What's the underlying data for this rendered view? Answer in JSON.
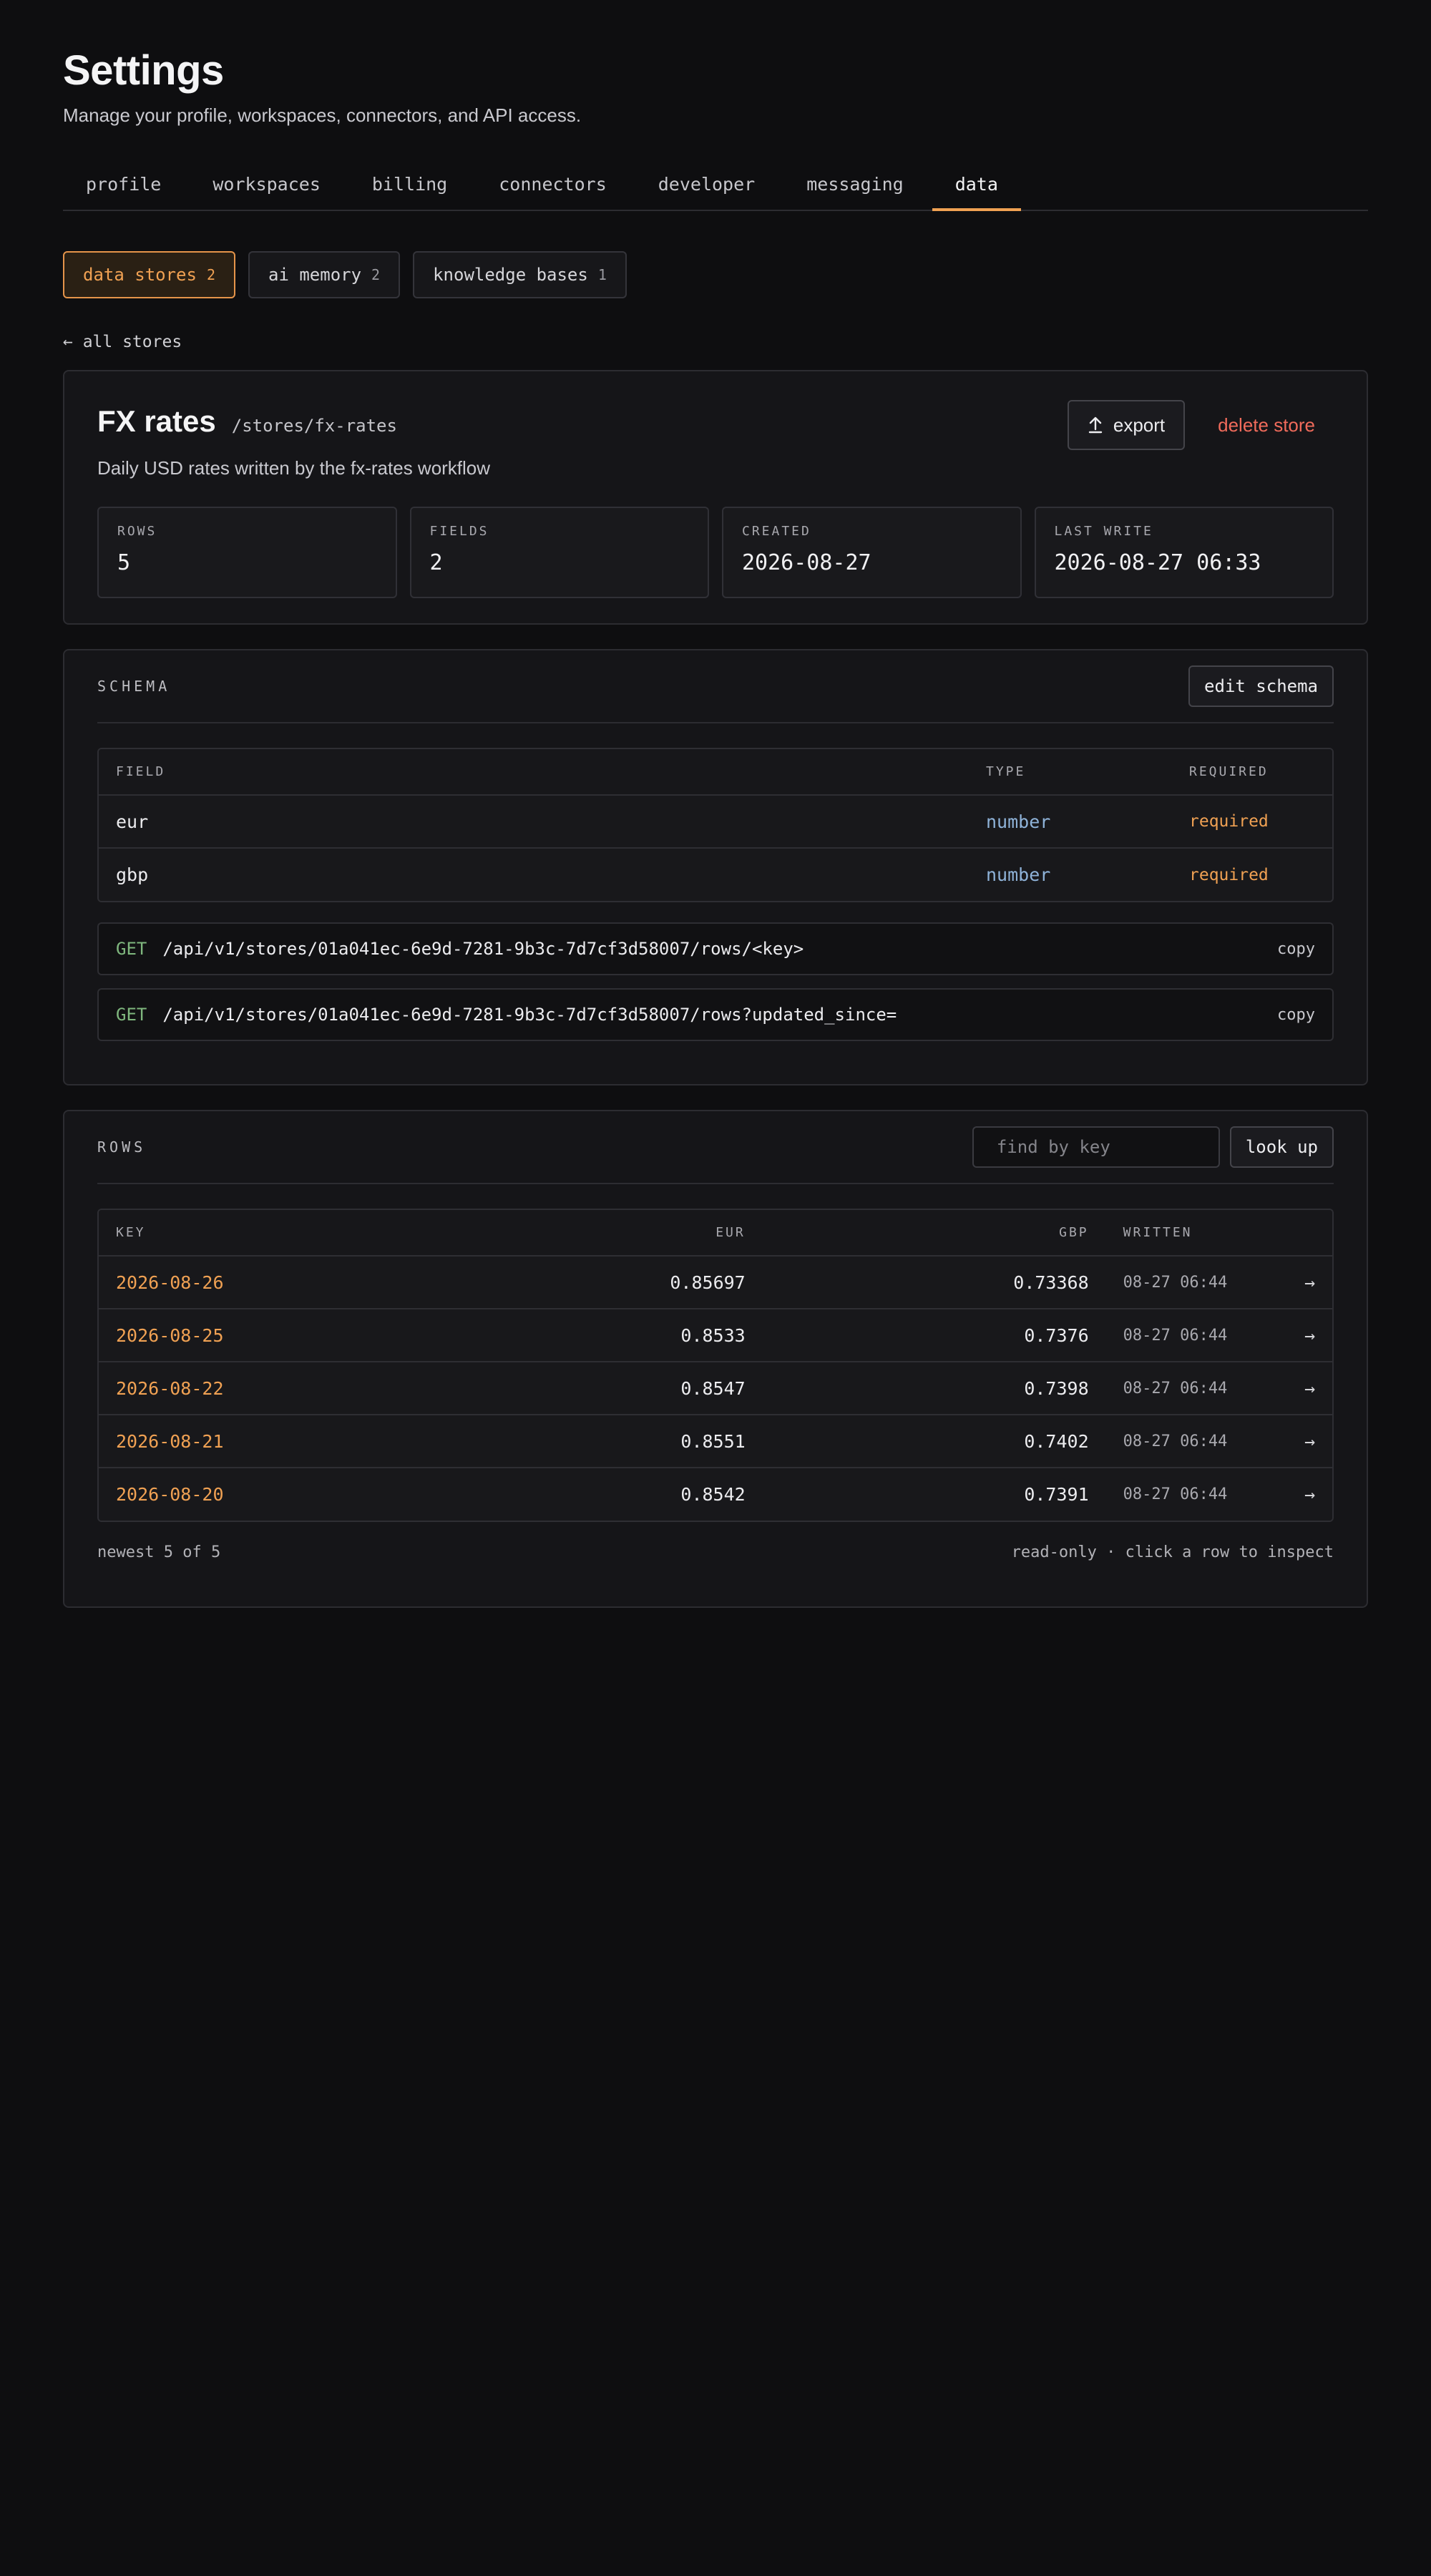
{
  "header": {
    "title": "Settings",
    "subtitle": "Manage your profile, workspaces, connectors, and API access."
  },
  "tabs": [
    {
      "label": "profile"
    },
    {
      "label": "workspaces"
    },
    {
      "label": "billing"
    },
    {
      "label": "connectors"
    },
    {
      "label": "developer"
    },
    {
      "label": "messaging"
    },
    {
      "label": "data",
      "active": true
    }
  ],
  "subtabs": [
    {
      "label": "data stores",
      "count": "2",
      "active": true
    },
    {
      "label": "ai memory",
      "count": "2"
    },
    {
      "label": "knowledge bases",
      "count": "1"
    }
  ],
  "back_link": "← all stores",
  "store": {
    "name": "FX rates",
    "path": "/stores/fx-rates",
    "description": "Daily USD rates written by the fx-rates workflow",
    "export_label": "export",
    "delete_label": "delete store",
    "stats": [
      {
        "label": "ROWS",
        "value": "5"
      },
      {
        "label": "FIELDS",
        "value": "2"
      },
      {
        "label": "CREATED",
        "value": "2026-08-27"
      },
      {
        "label": "LAST WRITE",
        "value": "2026-08-27 06:33"
      }
    ]
  },
  "schema": {
    "label": "SCHEMA",
    "edit_label": "edit schema",
    "columns": [
      "FIELD",
      "TYPE",
      "REQUIRED"
    ],
    "fields": [
      {
        "field": "eur",
        "type": "number",
        "required": "required"
      },
      {
        "field": "gbp",
        "type": "number",
        "required": "required"
      }
    ],
    "endpoints": [
      {
        "method": "GET",
        "path": "/api/v1/stores/01a041ec-6e9d-7281-9b3c-7d7cf3d58007/rows/<key>",
        "copy": "copy"
      },
      {
        "method": "GET",
        "path": "/api/v1/stores/01a041ec-6e9d-7281-9b3c-7d7cf3d58007/rows?updated_since=",
        "copy": "copy"
      }
    ]
  },
  "rows": {
    "label": "ROWS",
    "search_placeholder": "find by key",
    "lookup_label": "look up",
    "columns": [
      "KEY",
      "EUR",
      "GBP",
      "WRITTEN"
    ],
    "items": [
      {
        "key": "2026-08-26",
        "eur": "0.85697",
        "gbp": "0.73368",
        "written": "08-27 06:44",
        "arrow": "→"
      },
      {
        "key": "2026-08-25",
        "eur": "0.8533",
        "gbp": "0.7376",
        "written": "08-27 06:44",
        "arrow": "→"
      },
      {
        "key": "2026-08-22",
        "eur": "0.8547",
        "gbp": "0.7398",
        "written": "08-27 06:44",
        "arrow": "→"
      },
      {
        "key": "2026-08-21",
        "eur": "0.8551",
        "gbp": "0.7402",
        "written": "08-27 06:44",
        "arrow": "→"
      },
      {
        "key": "2026-08-20",
        "eur": "0.8542",
        "gbp": "0.7391",
        "written": "08-27 06:44",
        "arrow": "→"
      }
    ],
    "footer_left": "newest 5 of 5",
    "footer_right": "read-only · click a row to inspect"
  },
  "colors": {
    "accent": "#f0a153",
    "danger": "#f06b5b",
    "type_number": "#8fb3d9",
    "method_get": "#7fb77e",
    "background": "#0e0e10"
  }
}
